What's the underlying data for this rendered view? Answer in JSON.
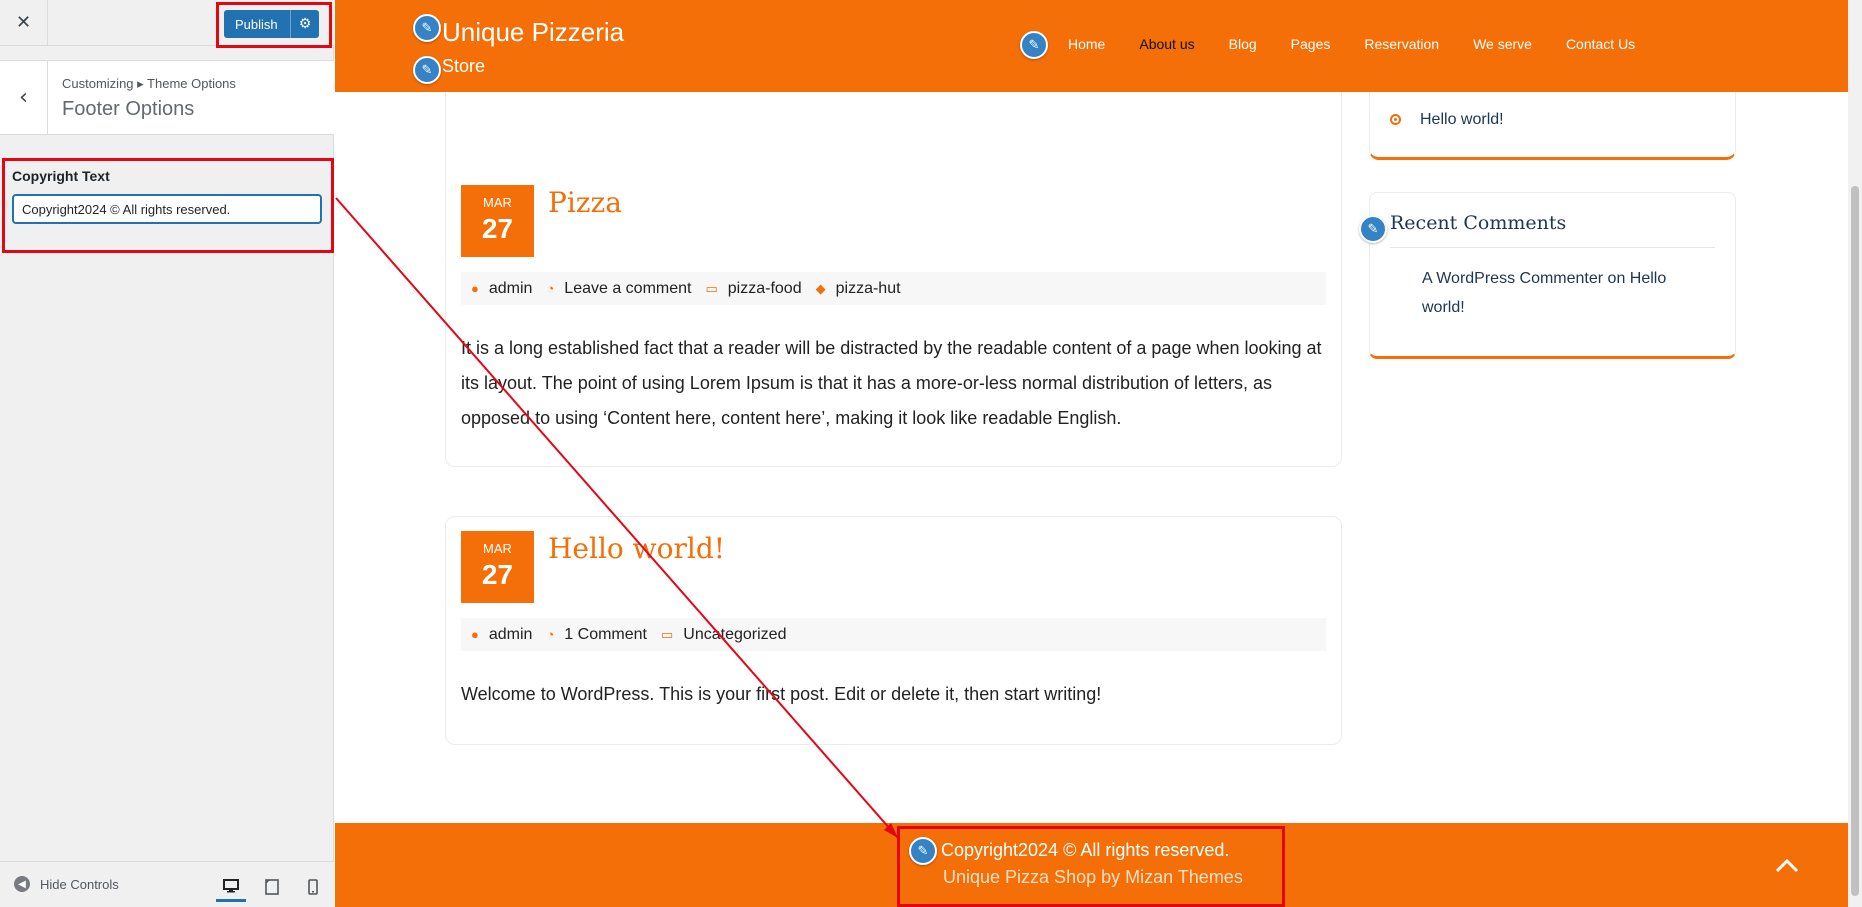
{
  "customizer": {
    "close_label": "✕",
    "publish_label": "Publish",
    "breadcrumb": "Customizing ▸ Theme Options",
    "section_title": "Footer Options",
    "control_label": "Copyright Text",
    "control_value": "Copyright2024 © All rights reserved.",
    "hide_controls_label": "Hide Controls",
    "annotation_color": "#e30613",
    "accent_color": "#2271b1"
  },
  "site": {
    "title": "Unique Pizzeria",
    "tagline": "Store",
    "brand_color": "#f46f07",
    "nav": [
      "Home",
      "About us",
      "Blog",
      "Pages",
      "Reservation",
      "We serve",
      "Contact Us"
    ],
    "nav_active": "About us"
  },
  "posts": [
    {
      "month": "MAR",
      "day": "27",
      "title": "Pizza",
      "author": "admin",
      "comments": "Leave a comment",
      "category": "pizza-food",
      "tag": "pizza-hut",
      "excerpt": "It is a long established fact that a reader will be distracted by the readable content of a page when looking at its layout. The point of using Lorem Ipsum is that it has a more-or-less normal distribution of letters, as opposed to using ‘Content here, content here’, making it look like readable English."
    },
    {
      "month": "MAR",
      "day": "27",
      "title": "Hello world!",
      "author": "admin",
      "comments": "1 Comment",
      "category": "Uncategorized",
      "excerpt": "Welcome to WordPress. This is your first post. Edit or delete it, then start writing!"
    }
  ],
  "sidebar_widgets": {
    "recent_post": "Hello world!",
    "recent_comments_title": "Recent Comments",
    "comment_author": "A WordPress Commenter",
    "comment_on": "on",
    "comment_post": "Hello world!"
  },
  "footer": {
    "copyright": "Copyright2024 © All rights reserved.",
    "credit": "Unique Pizza Shop by Mizan Themes"
  }
}
